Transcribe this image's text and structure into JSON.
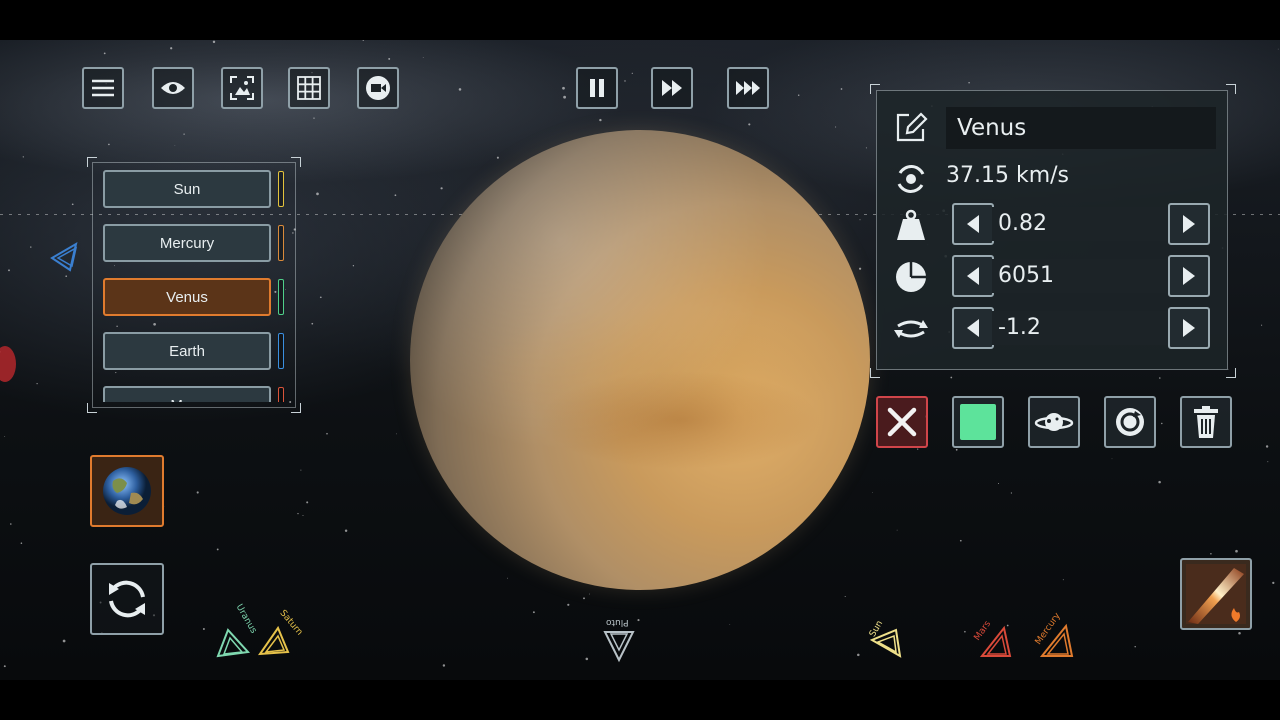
{
  "toolbar_left": [
    {
      "icon": "menu-icon"
    },
    {
      "icon": "eye-icon"
    },
    {
      "icon": "screenshot-icon"
    },
    {
      "icon": "grid-icon"
    },
    {
      "icon": "camera-record-icon"
    }
  ],
  "toolbar_time": [
    {
      "icon": "pause-icon"
    },
    {
      "icon": "fast-forward-icon"
    },
    {
      "icon": "faster-forward-icon"
    }
  ],
  "object_list": {
    "items": [
      {
        "label": "Sun",
        "tag_color": "#e3c23c"
      },
      {
        "label": "Mercury",
        "tag_color": "#d98a3a"
      },
      {
        "label": "Venus",
        "tag_color": "#4fd08a",
        "selected": true
      },
      {
        "label": "Earth",
        "tag_color": "#3a8fe0"
      },
      {
        "label": "Mars",
        "tag_color": "#d9543a"
      }
    ]
  },
  "info": {
    "name": "Venus",
    "speed": "37.15 km/s",
    "mass_value": "0.82",
    "radius_value": "6051",
    "rotation_value": "-1.2"
  },
  "actions": {
    "color_swatch": "#5de39b"
  },
  "markers": {
    "uranus": "Uranus",
    "saturn": "Saturn",
    "pluto": "Pluto",
    "sun": "Sun",
    "mars": "Mars",
    "mercury": "Mercury"
  },
  "colors": {
    "accent_orange": "#e07b2e",
    "close_red": "#d0454a",
    "frame_gray": "#8fa0a8"
  }
}
